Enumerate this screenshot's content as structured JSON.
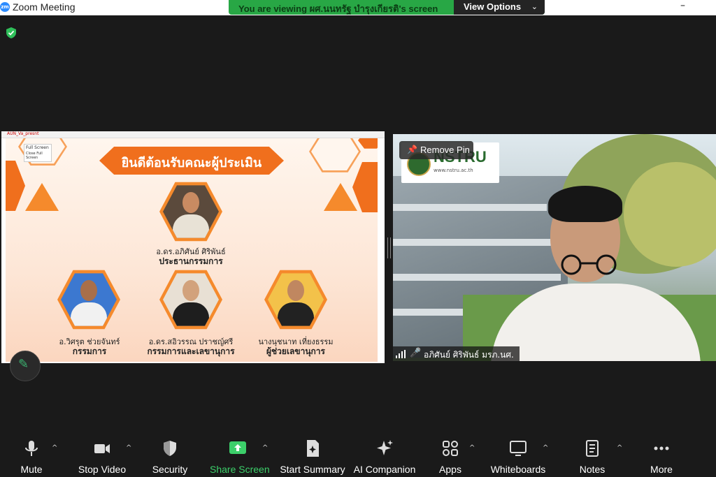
{
  "window": {
    "logo_text": "zm",
    "title": "Zoom Meeting",
    "minimize_glyph": "–"
  },
  "banner": {
    "viewing_text": "You are viewing ผศ.นนทรัฐ บำรุงเกียรติ's screen",
    "view_options_label": "View Options"
  },
  "shared_screen": {
    "tab_label": "AUN_Va_presnt",
    "fullscreen_popup": [
      "Full Screen",
      "Close Full Screen"
    ],
    "slide_title": "ยินดีต้อนรับคณะผู้ประเมิน",
    "people": [
      {
        "name": "อ.ดร.อภิศันย์ ศิริพันธ์",
        "role": "ประธานกรรมการ"
      },
      {
        "name": "อ.วิศรุต ช่วยจันทร์",
        "role": "กรรมการ"
      },
      {
        "name": "อ.ดร.สอิวรรณ ปราชญ์ศรี",
        "role": "กรรมการและเลขานุการ"
      },
      {
        "name": "นางนุชนาท เที่ยงธรรม",
        "role": "ผู้ช่วยเลขานุการ"
      }
    ]
  },
  "video": {
    "logo_text": "NSTRU",
    "logo_url": "www.nstru.ac.th",
    "remove_pin_label": "Remove Pin",
    "participant_name": "อภิศันย์ ศิริพันธ์ มรภ.นศ."
  },
  "toolbar": {
    "items": [
      {
        "label": "Mute",
        "icon": "microphone-icon"
      },
      {
        "label": "Stop Video",
        "icon": "video-camera-icon"
      },
      {
        "label": "Security",
        "icon": "shield-icon"
      },
      {
        "label": "Share Screen",
        "icon": "share-screen-icon"
      },
      {
        "label": "Start Summary",
        "icon": "document-sparkle-icon"
      },
      {
        "label": "AI Companion",
        "icon": "sparkle-icon"
      },
      {
        "label": "Apps",
        "icon": "apps-icon"
      },
      {
        "label": "Whiteboards",
        "icon": "whiteboard-icon"
      },
      {
        "label": "Notes",
        "icon": "notes-icon"
      },
      {
        "label": "More",
        "icon": "more-dots-icon"
      }
    ]
  },
  "colors": {
    "share_green": "#3ccf6a",
    "banner_green": "#28a745",
    "slide_orange": "#f06f1d",
    "background": "#1a1a1a"
  }
}
